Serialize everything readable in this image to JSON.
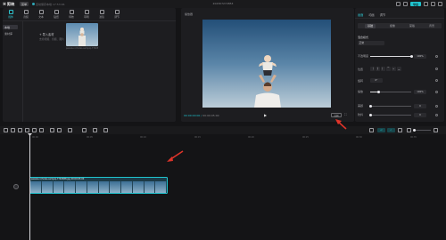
{
  "app": {
    "logo": "剪映",
    "menu_label": "菜单",
    "autosave": "自动保存本地 17:53:06",
    "doc_title": "202307272853",
    "export_label": "导出"
  },
  "colors": {
    "accent": "#20c4cf",
    "panel": "#1d1d20",
    "background": "#141416",
    "clip": "#1c3b47"
  },
  "toolbar": {
    "tabs": [
      {
        "label": "媒体",
        "icon": "media-icon"
      },
      {
        "label": "音频",
        "icon": "audio-icon"
      },
      {
        "label": "文本",
        "icon": "text-icon"
      },
      {
        "label": "贴纸",
        "icon": "sticker-icon"
      },
      {
        "label": "特效",
        "icon": "effects-icon"
      },
      {
        "label": "转场",
        "icon": "transition-icon"
      },
      {
        "label": "滤镜",
        "icon": "filter-icon"
      },
      {
        "label": "调节",
        "icon": "adjust-icon"
      }
    ]
  },
  "media": {
    "side_items": [
      "本地",
      "素材库"
    ],
    "import_label": "导入素材",
    "import_sub": "支持视频、音频、图片",
    "thumb_caption": "pexels-nicholas-sampiq-7740888.jpg"
  },
  "player": {
    "title": "播放器",
    "time_current": "00:00:00:00",
    "time_total": "00:00:05:00",
    "ratio_label": "比例",
    "fullscreen_icon": "fullscreen-icon"
  },
  "properties": {
    "tabs": [
      "画面",
      "动画",
      "调节"
    ],
    "subtabs": [
      "基础",
      "抠像",
      "蒙版",
      "背景"
    ],
    "section_title": "混合模式",
    "blend_value": "正常",
    "opacity_label": "不透明度",
    "opacity_value": "100%",
    "opacity_level": 1.0,
    "position_label": "位置",
    "rotate_label": "旋转",
    "rotate_value": "0°",
    "scale_label": "缩放",
    "scale_value": "100%",
    "scale_level": 0.2,
    "x_label": "X",
    "y_label": "Y",
    "x_value": "0",
    "y_value": "0",
    "beauty_label": "美颜",
    "beauty_level": 0.0,
    "stabilize_label": "防抖",
    "stabilize_level": 0.0
  },
  "timeline": {
    "ruler_ticks": [
      "00:00",
      "00:05",
      "00:10",
      "00:15",
      "00:20",
      "00:25",
      "00:30",
      "00:35"
    ],
    "clip_label": "pexels-nicholas-sampiq-7740888.jpg  00:00:05:00",
    "cover_label": "封面"
  }
}
